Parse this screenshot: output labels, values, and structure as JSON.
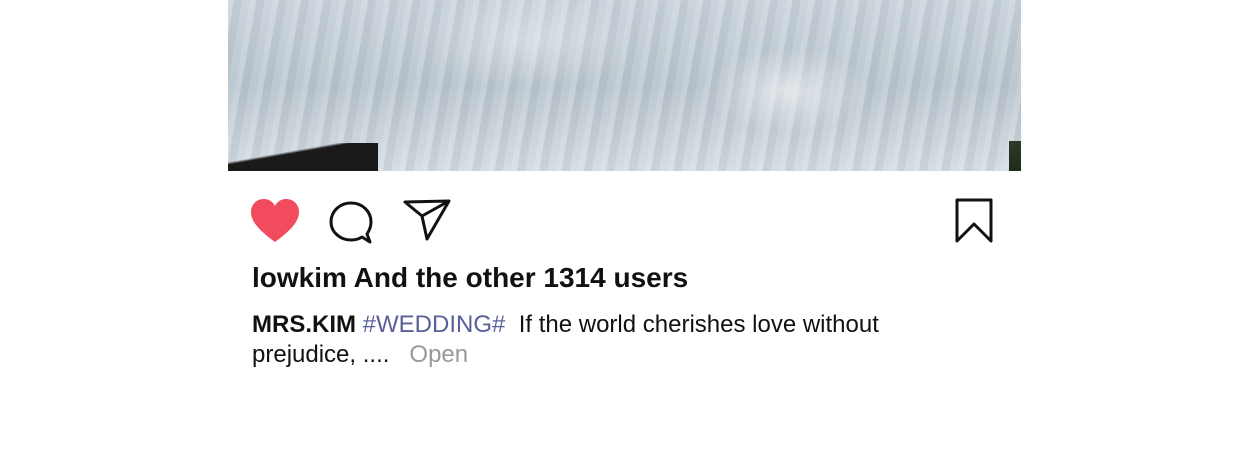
{
  "post": {
    "photo_alt": "",
    "likes_text": "lowkim And the other 1314 users",
    "caption": {
      "username": "MRS.KIM",
      "hashtag": "#WEDDING#",
      "text_line1": "If the world cherishes love without",
      "text_line2": "prejudice, ....",
      "more_label": "Open"
    }
  },
  "actions": {
    "like_icon": "heart-icon",
    "comment_icon": "comment-bubble-icon",
    "share_icon": "paper-plane-icon",
    "save_icon": "bookmark-icon",
    "like_color": "#f24b5e"
  }
}
